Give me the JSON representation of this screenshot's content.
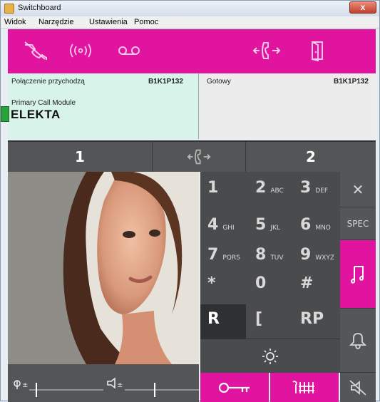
{
  "window": {
    "title": "Switchboard",
    "close_glyph": "x"
  },
  "menu": {
    "items": [
      "Widok",
      "Narzędzie",
      "Ustawienia",
      "Pomoc"
    ]
  },
  "toolbar": {
    "icons": [
      "hangup-phone-icon",
      "radio-waves-icon",
      "voicemail-icon",
      "transfer-call-icon",
      "exit-door-icon"
    ],
    "color": "#e0149e"
  },
  "status_left": {
    "state": "Połączenie przychodzą",
    "code": "B1K1P132",
    "module": "Primary Call Module",
    "name": "ELEKTA"
  },
  "status_right": {
    "state": "Gotowy",
    "code": "B1K1P132"
  },
  "tabs": {
    "left": "1",
    "right": "2"
  },
  "keypad": {
    "keys": [
      {
        "num": "1",
        "letters": ""
      },
      {
        "num": "2",
        "letters": "ABC"
      },
      {
        "num": "3",
        "letters": "DEF"
      },
      {
        "num": "4",
        "letters": "GHI"
      },
      {
        "num": "5",
        "letters": "JKL"
      },
      {
        "num": "6",
        "letters": "MNO"
      },
      {
        "num": "7",
        "letters": "PQRS"
      },
      {
        "num": "8",
        "letters": "TUV"
      },
      {
        "num": "9",
        "letters": "WXYZ"
      },
      {
        "num": "*",
        "letters": ""
      },
      {
        "num": "0",
        "letters": ""
      },
      {
        "num": "#",
        "letters": ""
      }
    ],
    "r_label": "R",
    "bracket_label": "[",
    "rp_label": "RP"
  },
  "side": {
    "clear_glyph": "✕",
    "spec_label": "SPEC"
  },
  "colors": {
    "accent": "#e0149e",
    "panel": "#4a4b4d",
    "status_green": "#d7f3ea"
  }
}
